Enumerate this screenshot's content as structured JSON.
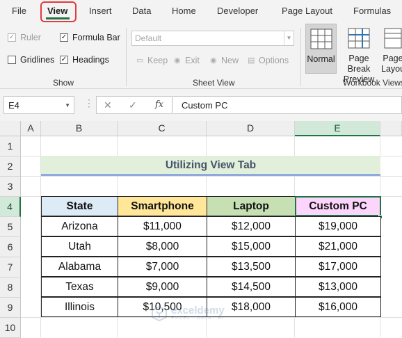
{
  "ribbon": {
    "tabs": [
      {
        "label": "File"
      },
      {
        "label": "View"
      },
      {
        "label": "Insert"
      },
      {
        "label": "Data"
      },
      {
        "label": "Home"
      },
      {
        "label": "Developer"
      },
      {
        "label": "Page Layout"
      },
      {
        "label": "Formulas"
      }
    ],
    "show": {
      "ruler": "Ruler",
      "formula_bar": "Formula Bar",
      "gridlines": "Gridlines",
      "headings": "Headings",
      "label": "Show"
    },
    "sheet_view": {
      "dropdown_value": "Default",
      "keep": "Keep",
      "exit": "Exit",
      "new": "New",
      "options": "Options",
      "label": "Sheet View"
    },
    "workbook_views": {
      "normal": "Normal",
      "page_break_1": "Page Break",
      "page_break_2": "Preview",
      "page_layout_1": "Page",
      "page_layout_2": "Layout",
      "label": "Workbook Views"
    }
  },
  "formula_bar": {
    "name_box": "E4",
    "formula": "Custom PC"
  },
  "grid": {
    "columns": [
      "A",
      "B",
      "C",
      "D",
      "E"
    ],
    "rows": [
      "1",
      "2",
      "3",
      "4",
      "5",
      "6",
      "7",
      "8",
      "9",
      "10"
    ],
    "title": "Utilizing View Tab",
    "headers": [
      "State",
      "Smartphone",
      "Laptop",
      "Custom PC"
    ],
    "header_colors": [
      "#ddebf7",
      "#ffe699",
      "#c6e0b4",
      "#fcd5fc"
    ],
    "data_rows": [
      [
        "Arizona",
        "$11,000",
        "$12,000",
        "$19,000"
      ],
      [
        "Utah",
        "$8,000",
        "$15,000",
        "$21,000"
      ],
      [
        "Alabama",
        "$7,000",
        "$13,500",
        "$17,000"
      ],
      [
        "Texas",
        "$9,000",
        "$14,500",
        "$13,000"
      ],
      [
        "Illinois",
        "$10,500",
        "$18,000",
        "$16,000"
      ]
    ]
  },
  "watermark": {
    "name": "exceldemy",
    "sub": "EXCEL · DATA · BI"
  }
}
